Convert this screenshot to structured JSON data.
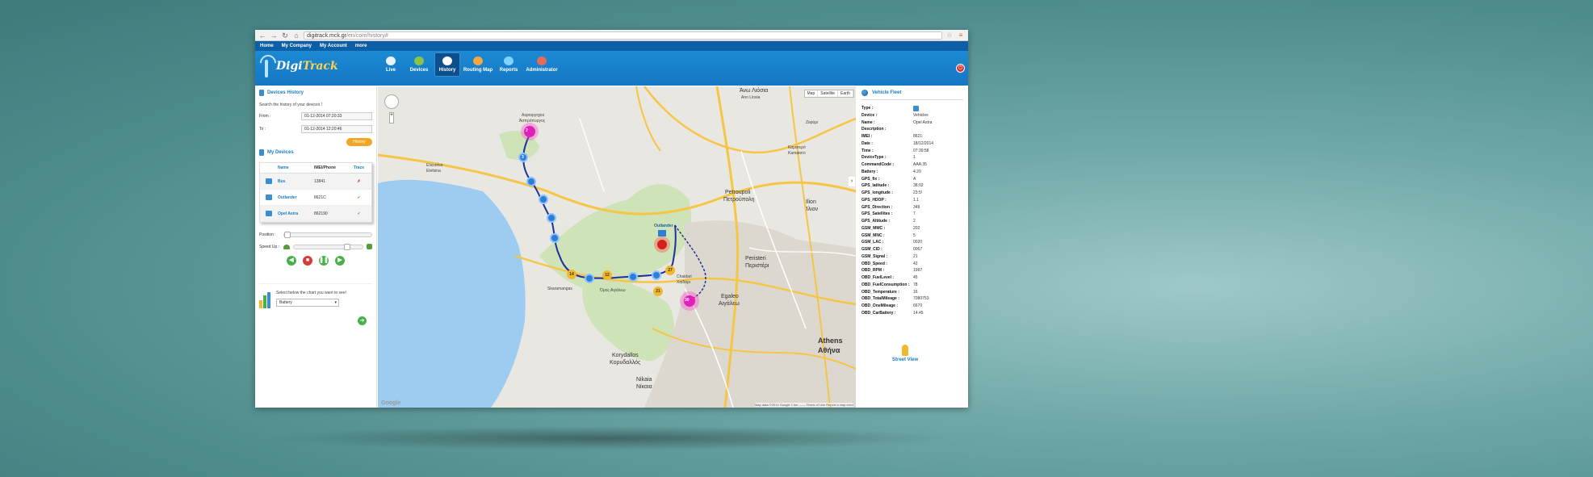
{
  "browser": {
    "url_host": "digitrack.mck.gr",
    "url_path": "/en/core/history#"
  },
  "topnav": [
    "Home",
    "My Company",
    "My Account",
    "more"
  ],
  "app": {
    "logo_part1": "Digi",
    "logo_part2": "Track"
  },
  "mainnav": [
    {
      "label": "Live",
      "color": "#e9f3ff"
    },
    {
      "label": "Devices",
      "color": "#8bc34a"
    },
    {
      "label": "History",
      "color": "#ffffff"
    },
    {
      "label": "Routing Map",
      "color": "#f4a742"
    },
    {
      "label": "Reports",
      "color": "#7fd3ff"
    },
    {
      "label": "Administrator",
      "color": "#e86a5a"
    }
  ],
  "left": {
    "history_title": "Devices History",
    "history_hint": "Search the history of your devices !",
    "from_label": "From :",
    "from_value": "01-12-2014 07:20:33",
    "to_label": "To :",
    "to_value": "01-12-2014 12:20:46",
    "history_button": "History",
    "devices_title": "My Devices",
    "columns": {
      "name": "Name",
      "imei": "IMEI/Phone",
      "trace": "Trace"
    },
    "devices": [
      {
        "name": "Bus",
        "imei": "13841",
        "trace": "✗",
        "trace_color": "#d63b3b"
      },
      {
        "name": "Outlander",
        "imei": "8621C",
        "trace": "✓",
        "trace_color": "#3aa23a"
      },
      {
        "name": "Opel Astra",
        "imei": "862190",
        "trace": "✓",
        "trace_color": "#3aa23a"
      }
    ],
    "position_label": "Position :",
    "speed_label": "Speed Up :",
    "chart_prompt": "Select below the chart you want to see!",
    "chart_selected": "Battery"
  },
  "map": {
    "type_buttons": [
      "Map",
      "Satellite",
      "Earth"
    ],
    "google": "Google",
    "copyright": "Map data ©2014 Google   1 km ——   Terms of Use   Report a map error",
    "labels": {
      "ano_liosia": "Άνω Λιόσια",
      "ano_liosia_en": "Ano Liosia",
      "aspropyrgos": "Άσπρόπυργος",
      "aspropyrgos_en": "Aspropyrgos",
      "elefsina": "Ελευσίνα",
      "elefsina_en": "Elefsina",
      "zefyri": "Ζεφύρι",
      "kamatero": "Καματερό",
      "kamatero_en": "Kamatero",
      "petroupoli": "Petroupoli",
      "petroupoli_gr": "Πετρούπολη",
      "ilion": "Ilion",
      "ilion_gr": "Ίλιον",
      "peristeri": "Peristeri",
      "peristeri_gr": "Περιστέρι",
      "egaleo": "Egaleo",
      "egaleo_gr": "Αιγάλεω",
      "chaidari": "Chaidari",
      "chaidari_gr": "Χαϊδάρι",
      "skaramangas": "Skaramangas",
      "athens": "Athens",
      "athens_gr": "Αθήνα",
      "korydallos": "Korydallos",
      "korydallos_gr": "Κορυδαλλός",
      "nikaia": "Nikaia",
      "nikaia_gr": "Νίκαια",
      "outlander_tag": "Outlander",
      "poikilo_oros": "Όρος Αιγάλεω"
    },
    "markers": [
      "2",
      "3",
      "14",
      "12",
      "27",
      "21",
      "30",
      "25",
      "16",
      "13"
    ]
  },
  "right": {
    "title": "Vehicle Fleet",
    "props": [
      {
        "k": "Type :",
        "v": ""
      },
      {
        "k": "Device :",
        "v": "Vehicles"
      },
      {
        "k": "Name :",
        "v": "Opel Astra"
      },
      {
        "k": "Description :",
        "v": ""
      },
      {
        "k": "IMEI :",
        "v": "8621:"
      },
      {
        "k": "Date :",
        "v": "18/12/2014"
      },
      {
        "k": "Time :",
        "v": "07:39:58"
      },
      {
        "k": "DeviceType :",
        "v": "1"
      },
      {
        "k": "CommandCode :",
        "v": "AAA:35"
      },
      {
        "k": "Battery :",
        "v": "4.20"
      },
      {
        "k": "GPS_fix :",
        "v": "A"
      },
      {
        "k": "GPS_latitude :",
        "v": "38:02"
      },
      {
        "k": "GPS_longitude :",
        "v": "23:5!"
      },
      {
        "k": "GPS_HDOP :",
        "v": "1.1"
      },
      {
        "k": "GPS_Direction :",
        "v": "349"
      },
      {
        "k": "GPS_Satellites :",
        "v": "7"
      },
      {
        "k": "GPS_Altitude :",
        "v": "2"
      },
      {
        "k": "GSM_MMC :",
        "v": "202"
      },
      {
        "k": "GSM_MNC :",
        "v": "5"
      },
      {
        "k": "GSM_LAC :",
        "v": "0020"
      },
      {
        "k": "GSM_CID :",
        "v": "0067"
      },
      {
        "k": "GSM_Signal :",
        "v": "21"
      },
      {
        "k": "OBD_Speed :",
        "v": "42"
      },
      {
        "k": "OBD_RPM :",
        "v": "1997"
      },
      {
        "k": "OBD_FuelLevel :",
        "v": "45"
      },
      {
        "k": "OBD_FuelConsumption :",
        "v": "78"
      },
      {
        "k": "OBD_Temperature :",
        "v": "16"
      },
      {
        "k": "OBD_TotalMileage :",
        "v": "7080753"
      },
      {
        "k": "OBD_OneMileage :",
        "v": "6670"
      },
      {
        "k": "OBD_CarBattery :",
        "v": "14.45"
      }
    ],
    "street_view": "Street View"
  }
}
